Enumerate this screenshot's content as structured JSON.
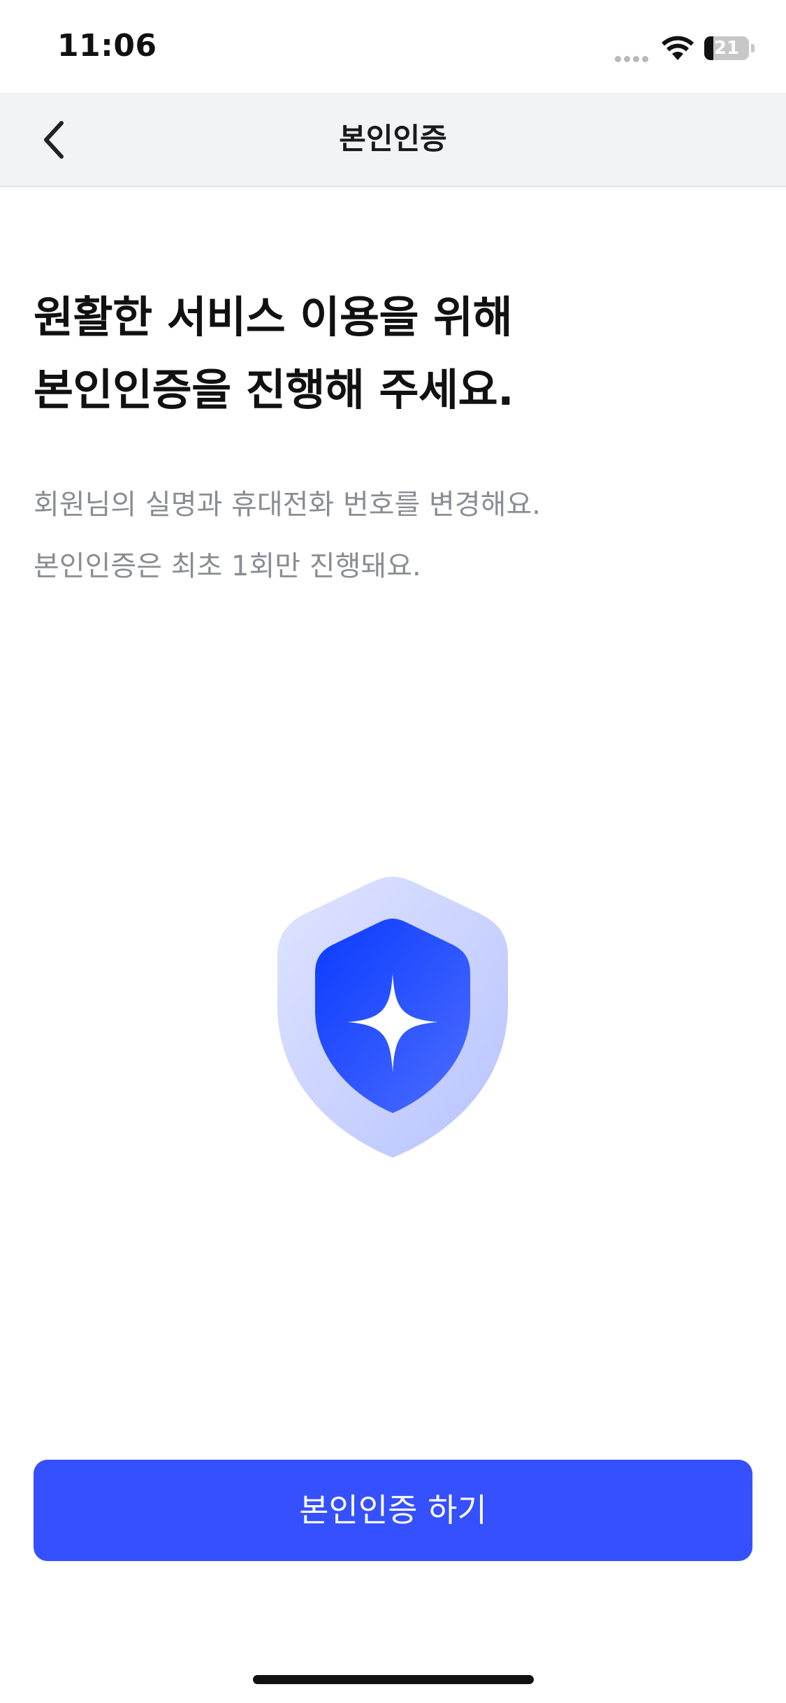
{
  "status_bar": {
    "time": "11:06",
    "battery_level": "21",
    "battery_fraction": 0.21
  },
  "nav": {
    "title": "본인인증",
    "back_icon": "chevron-left-icon"
  },
  "headline": {
    "line1": "원활한 서비스 이용을 위해",
    "line2": "본인인증을 진행해 주세요."
  },
  "description": {
    "line1": "회원님의 실명과 휴대전화 번호를 변경해요.",
    "line2": "본인인증은 최초 1회만 진행돼요."
  },
  "illustration": {
    "icon": "shield-sparkle-icon",
    "colors": {
      "outer": "#d6dcff",
      "inner": "#1d4bff",
      "sparkle": "#ffffff"
    }
  },
  "cta": {
    "label": "본인인증 하기",
    "color": "#3550ff"
  }
}
